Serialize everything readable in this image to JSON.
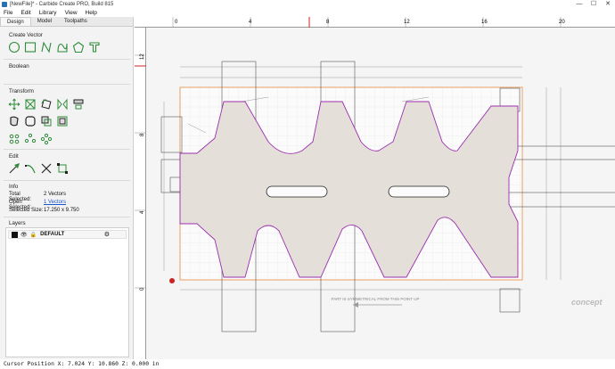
{
  "window": {
    "title": "[NewFile]* - Carbide Create PRO, Build 815",
    "controls": [
      "—",
      "☐",
      "✕"
    ]
  },
  "menu": [
    "File",
    "Edit",
    "Library",
    "View",
    "Help"
  ],
  "tabs": [
    {
      "label": "Design",
      "active": true
    },
    {
      "label": "Model",
      "active": false
    },
    {
      "label": "Toolpaths",
      "active": false
    }
  ],
  "panel": {
    "create_vector_title": "Create Vector",
    "create_vector_icons": [
      "circle-icon",
      "rectangle-icon",
      "polyline-icon",
      "curve-icon",
      "polygon-icon",
      "text-icon"
    ],
    "boolean_title": "Boolean",
    "transform_title": "Transform",
    "transform_icons": [
      "move-icon",
      "scale-icon",
      "rotate-icon",
      "mirror-icon",
      "align-icon",
      "offset-icon",
      "fillet-icon",
      "group-icon",
      "ungroup-icon",
      "array-icon",
      "circular-array-icon",
      "array-grid-icon"
    ],
    "edit_title": "Edit",
    "edit_icons": [
      "node-edit-icon",
      "curve-edit-icon",
      "trim-icon",
      "snap-icon"
    ],
    "info_title": "Info",
    "info": {
      "total_selected_label": "Total Selected:",
      "total_selected_value": "2 Vectors",
      "open_selected_label": "Open Selected:",
      "open_selected_value": "1 Vectors",
      "selected_size_label": "Selected Size:",
      "selected_size_value": "17.250 x 9.750"
    },
    "layers_title": "Layers",
    "layers": [
      {
        "name": "DEFAULT",
        "color": "#111111"
      }
    ]
  },
  "ruler": {
    "h_labels": [
      "0",
      "4",
      "8",
      "12",
      "16",
      "20"
    ],
    "v_labels": [
      "12",
      "8",
      "4",
      "0"
    ]
  },
  "drawing": {
    "note": "PART IS SYMMETRICAL FROM THIS POINT UP",
    "brand": "concept",
    "accent": "#cc2222",
    "part_fill": "#e4e0d9",
    "outline_orange": "#e8a060",
    "outline_purple": "#9b2fae"
  },
  "status": "Cursor Position X: 7.024 Y: 10.860 Z: 0.000 in"
}
